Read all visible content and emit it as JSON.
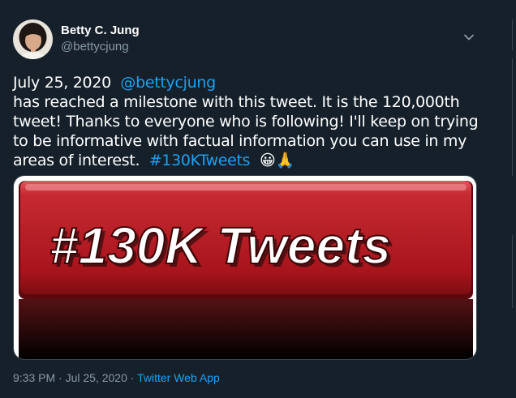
{
  "author": {
    "display_name": "Betty C. Jung",
    "handle": "@bettycjung"
  },
  "tweet": {
    "date_text": "July 25, 2020",
    "mention": "@bettycjung",
    "body": " has reached a milestone with this tweet. It is the 120,000th tweet! Thanks to everyone who is following! I'll keep on trying to be informative with factual information you can use in my areas of interest.",
    "hashtag": "#130KTweets",
    "emojis": "😀🙏"
  },
  "media": {
    "image_text": "#130K Tweets"
  },
  "footer": {
    "time": "9:33 PM · Jul 25, 2020",
    "separator": " · ",
    "source": "Twitter Web App"
  },
  "colors": {
    "background": "#15202b",
    "link": "#1da1f2",
    "secondary_text": "#8899a6",
    "button_red": "#b31b24"
  }
}
